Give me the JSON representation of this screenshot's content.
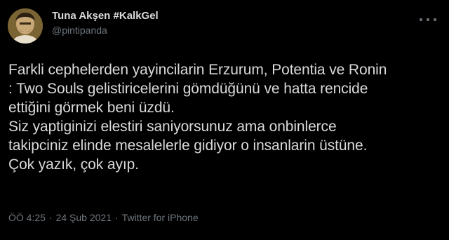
{
  "author": {
    "display_name": "Tuna Akşen #KalkGel",
    "handle": "@pintipanda"
  },
  "avatar": {
    "icon": "profile-photo"
  },
  "more_icon": "more-horizontal-icon",
  "tweet": {
    "lines": [
      "Farkli cephelerden yayincilarin Erzurum, Potentia ve Ronin",
      ": Two Souls gelistiricelerini gömdüğünü ve hatta rencide",
      "ettiğini görmek beni üzdü.",
      "Siz yaptiginizi elestiri saniyorsunuz ama onbinlerce",
      "takipciniz elinde mesalelerle gidiyor o insanlarin üstüne.",
      "Çok yazık, çok ayıp."
    ]
  },
  "meta": {
    "time": "ÖÖ 4:25",
    "separator": "·",
    "date": "24 Şub 2021",
    "source": "Twitter for iPhone"
  },
  "colors": {
    "background": "#000000",
    "text": "#d9d9d9",
    "muted": "#6e767d"
  }
}
